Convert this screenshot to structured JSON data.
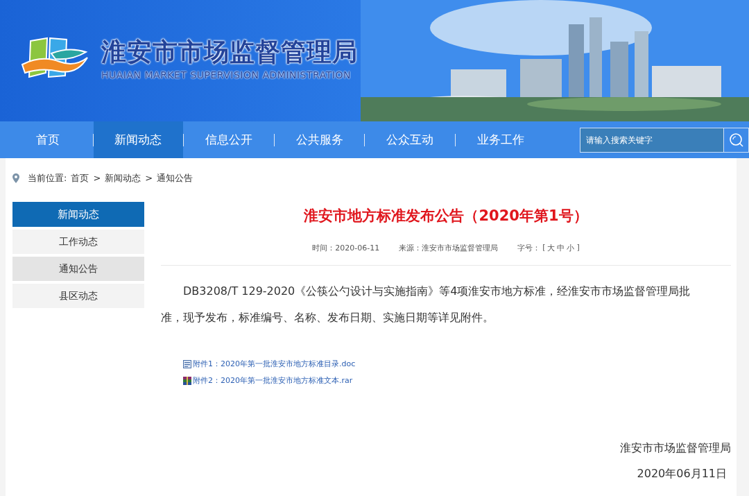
{
  "header": {
    "title": "淮安市市场监督管理局",
    "subtitle": "HUAIAN MARKET SUPERVISION ADMINISTRATION"
  },
  "nav": {
    "items": [
      {
        "label": "首页",
        "selected": false
      },
      {
        "label": "新闻动态",
        "selected": true
      },
      {
        "label": "信息公开",
        "selected": false
      },
      {
        "label": "公共服务",
        "selected": false
      },
      {
        "label": "公众互动",
        "selected": false
      },
      {
        "label": "业务工作",
        "selected": false
      }
    ],
    "search": {
      "placeholder": "请输入搜索关键字"
    }
  },
  "breadcrumb": {
    "label": "当前位置:",
    "items": [
      "首页",
      "新闻动态",
      "通知公告"
    ],
    "separator": ">"
  },
  "sidebar": {
    "title": "新闻动态",
    "items": [
      {
        "label": "工作动态",
        "selected": false
      },
      {
        "label": "通知公告",
        "selected": true
      },
      {
        "label": "县区动态",
        "selected": false
      }
    ]
  },
  "article": {
    "title": "淮安市地方标准发布公告（2020年第1号）",
    "meta": {
      "time": "时间：2020-06-11",
      "source": "来源：淮安市市场监督管理局",
      "font_size_label": "字号：",
      "font_size_open": "[",
      "font_size_options": [
        "大",
        "中",
        "小"
      ],
      "font_size_close": "]"
    },
    "body": "DB3208/T 129-2020《公筷公勺设计与实施指南》等4项淮安市地方标准，经淮安市市场监督管理局批准，现予发布，标准编号、名称、发布日期、实施日期等详见附件。",
    "attachments": [
      {
        "kind": "doc",
        "label": "附件1：2020年第一批淮安市地方标准目录.doc"
      },
      {
        "kind": "rar",
        "label": "附件2：2020年第一批淮安市地方标准文本.rar"
      }
    ],
    "signature": "淮安市市场监督管理局",
    "date": "2020年06月11日"
  }
}
